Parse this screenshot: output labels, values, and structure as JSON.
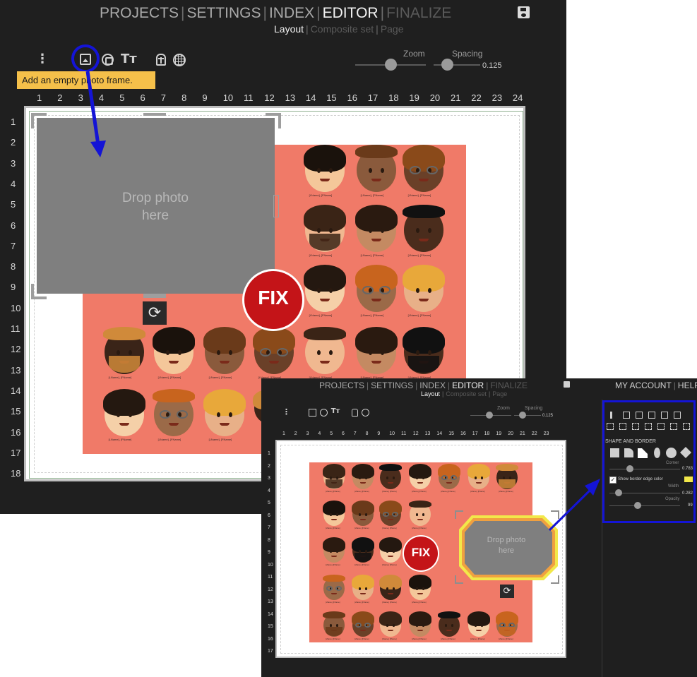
{
  "main": {
    "nav": {
      "projects": "PROJECTS",
      "settings": "SETTINGS",
      "index": "INDEX",
      "editor": "EDITOR",
      "finalize": "FINALIZE"
    },
    "subnav": {
      "layout": "Layout",
      "composite_set": "Composite set",
      "page": "Page"
    },
    "zoom_label": "Zoom",
    "spacing_label": "Spacing",
    "spacing_value": "0.125",
    "tooltip": "Add an empty photo frame.",
    "ruler_top": [
      "1",
      "2",
      "3",
      "4",
      "5",
      "6",
      "7",
      "8",
      "9",
      "10",
      "11",
      "12",
      "13",
      "14",
      "15",
      "16",
      "17",
      "18",
      "19",
      "20",
      "21",
      "22",
      "23",
      "24"
    ],
    "ruler_left": [
      "1",
      "2",
      "3",
      "4",
      "5",
      "6",
      "7",
      "8",
      "9",
      "10",
      "11",
      "12",
      "13",
      "14",
      "15",
      "16",
      "17",
      "18"
    ],
    "drop_photo": "Drop photo here",
    "fix": "FIX",
    "name_tag": "[LName], [FName]"
  },
  "inset": {
    "nav": {
      "projects": "PROJECTS",
      "settings": "SETTINGS",
      "index": "INDEX",
      "editor": "EDITOR",
      "finalize": "FINALIZE",
      "my_account": "MY ACCOUNT",
      "help": "HELP"
    },
    "subnav": {
      "layout": "Layout",
      "composite_set": "Composite set",
      "page": "Page"
    },
    "zoom_label": "Zoom",
    "spacing_label": "Spacing",
    "spacing_value": "0.125",
    "ruler_top": [
      "1",
      "2",
      "3",
      "4",
      "5",
      "6",
      "7",
      "8",
      "9",
      "10",
      "11",
      "12",
      "13",
      "14",
      "15",
      "16",
      "17",
      "18",
      "19",
      "20",
      "21",
      "22",
      "23"
    ],
    "ruler_left": [
      "1",
      "2",
      "3",
      "4",
      "5",
      "6",
      "7",
      "8",
      "9",
      "10",
      "11",
      "12",
      "13",
      "14",
      "15",
      "16",
      "17"
    ],
    "drop_photo": "Drop photo here",
    "fix": "FIX",
    "panel": {
      "section_title": "SHAPE AND BORDER",
      "corner_label": "Corner",
      "corner_value": "0.783",
      "show_border_label": "Show border edge color",
      "width_label": "Width",
      "width_value": "0.282",
      "opacity_label": "Opacity",
      "opacity_value": "99",
      "border_color": "#f2e84a"
    }
  },
  "colors": {
    "app_bg": "#1f1f1f",
    "canvas_bg": "#f07a68",
    "highlight_blue": "#1414d6",
    "tooltip_bg": "#f5c04a",
    "fix_red": "#c41418",
    "frame_gray": "#7f7f7f"
  }
}
